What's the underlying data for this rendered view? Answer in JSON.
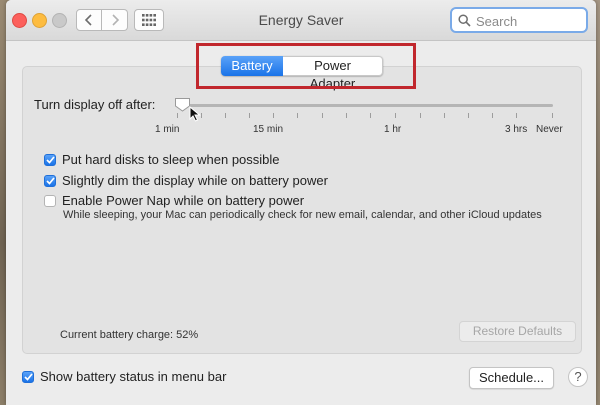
{
  "window": {
    "title": "Energy Saver",
    "search_placeholder": "Search"
  },
  "tabs": [
    {
      "label": "Battery",
      "selected": true
    },
    {
      "label": "Power Adapter",
      "selected": false
    }
  ],
  "display_sleep": {
    "label": "Turn display off after:",
    "ticks": [
      "1 min",
      "15 min",
      "1 hr",
      "3 hrs",
      "Never"
    ],
    "value": "1 min"
  },
  "options": [
    {
      "label": "Put hard disks to sleep when possible",
      "checked": true
    },
    {
      "label": "Slightly dim the display while on battery power",
      "checked": true
    },
    {
      "label": "Enable Power Nap while on battery power",
      "checked": false
    }
  ],
  "power_nap_description": "While sleeping, your Mac can periodically check for new email, calendar, and other iCloud updates",
  "battery_charge": "Current battery charge: 52%",
  "buttons": {
    "restore_defaults": "Restore Defaults",
    "schedule": "Schedule...",
    "help": "?"
  },
  "menu_bar_option": {
    "label": "Show battery status in menu bar",
    "checked": true
  },
  "colors": {
    "accent": "#1a73e8",
    "annotation": "#c1272d"
  },
  "icons": {
    "back": "chevron-left-icon",
    "forward": "chevron-right-icon",
    "show_all": "grid-icon",
    "search": "search-icon",
    "checkmark": "checkmark-icon"
  }
}
